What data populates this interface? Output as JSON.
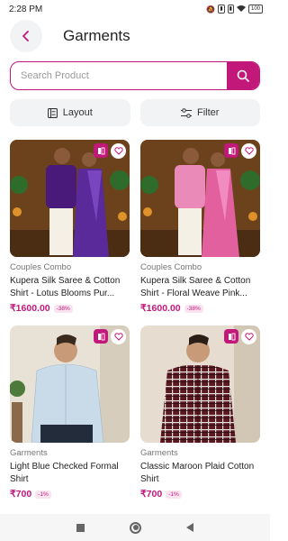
{
  "status_bar": {
    "time": "2:28 PM",
    "battery": "100"
  },
  "header": {
    "title": "Garments"
  },
  "search": {
    "placeholder": "Search Product"
  },
  "toolbar": {
    "layout_label": "Layout",
    "filter_label": "Filter"
  },
  "colors": {
    "accent": "#c2187a",
    "button_bg": "#f2f3f5"
  },
  "products": [
    {
      "category": "Couples Combo",
      "name": "Kupera Silk Saree & Cotton Shirt - Lotus Blooms Pur...",
      "price": "₹1600.00",
      "discount": "-38%"
    },
    {
      "category": "Couples Combo",
      "name": "Kupera Silk Saree & Cotton Shirt - Floral Weave Pink...",
      "price": "₹1600.00",
      "discount": "-38%"
    },
    {
      "category": "Garments",
      "name": "Light Blue Checked Formal Shirt",
      "price": "₹700",
      "discount": "-1%"
    },
    {
      "category": "Garments",
      "name": "Classic Maroon Plaid Cotton Shirt",
      "price": "₹700",
      "discount": "-1%"
    }
  ]
}
